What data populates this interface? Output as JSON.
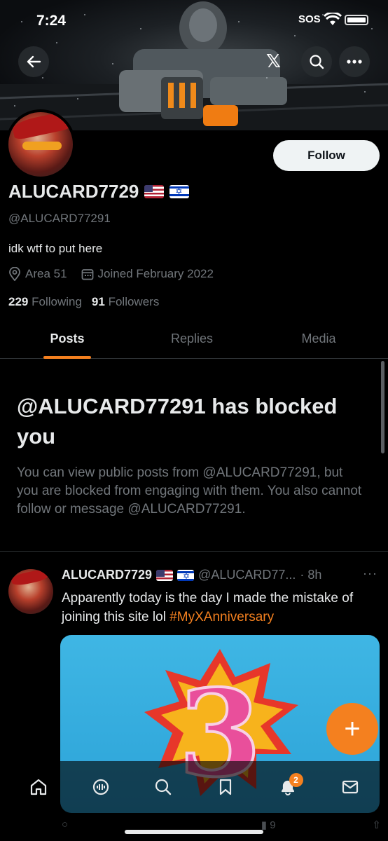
{
  "status": {
    "time": "7:24",
    "sos": "SOS"
  },
  "profile": {
    "display_name": "ALUCARD7729",
    "handle": "@ALUCARD77291",
    "bio": "idk wtf to put here",
    "location": "Area 51",
    "joined": "Joined February 2022",
    "following_count": "229",
    "following_label": "Following",
    "followers_count": "91",
    "followers_label": "Followers",
    "follow_label": "Follow"
  },
  "tabs": [
    {
      "label": "Posts",
      "active": true
    },
    {
      "label": "Replies",
      "active": false
    },
    {
      "label": "Media",
      "active": false
    }
  ],
  "blocked": {
    "title": "@ALUCARD77291 has blocked you",
    "body": "You can view public posts from @ALUCARD77291, but you are blocked from engaging with them. You also cannot follow or message @ALUCARD77291."
  },
  "post": {
    "name": "ALUCARD7729",
    "handle": "@ALUCARD77...",
    "time": "· 8h",
    "more": "···",
    "text_before": "Apparently today is the day I made the mistake of joining this site lol ",
    "hashtag": "#MyXAnniversary",
    "media_number": "3",
    "view_count": "9"
  },
  "nav": {
    "items": [
      "home-icon",
      "grok-icon",
      "search-icon",
      "bookmark-icon",
      "notifications-icon",
      "messages-icon"
    ],
    "notification_badge": "2"
  },
  "colors": {
    "accent": "#f4801f",
    "muted": "#71767b",
    "text": "#e7e9ea",
    "background": "#000000"
  },
  "fab": {
    "label": "+"
  }
}
